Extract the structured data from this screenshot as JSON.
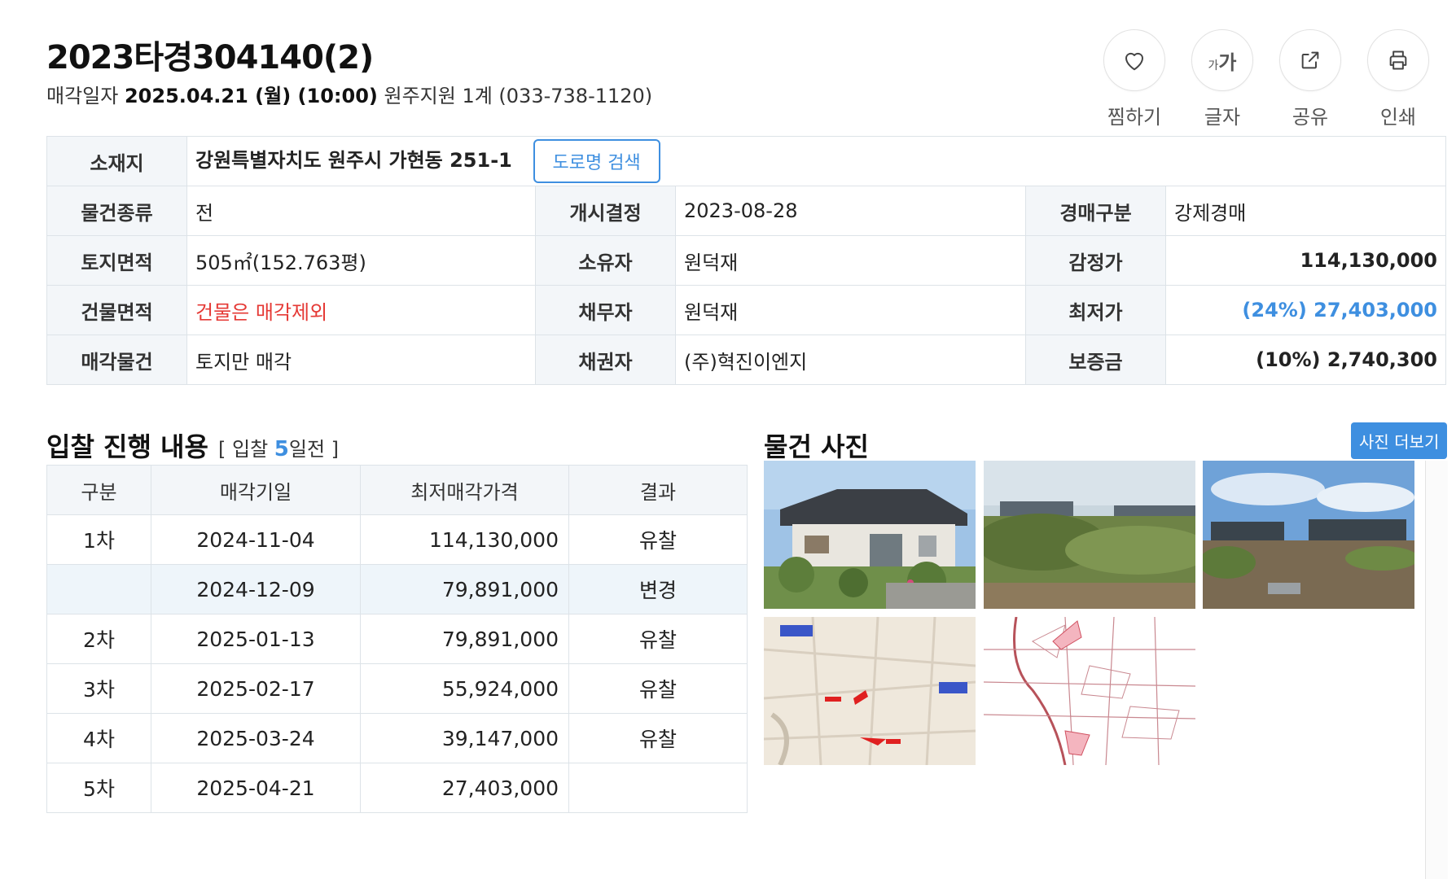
{
  "header": {
    "title": "2023타경304140(2)",
    "sale_label": "매각일자",
    "sale_date": "2025.04.21 (월) (10:00)",
    "court": "원주지원 1계 (033-738-1120)"
  },
  "actions": [
    {
      "label": "찜하기",
      "icon": "heart-icon"
    },
    {
      "label": "글자",
      "icon": "font-size-icon"
    },
    {
      "label": "공유",
      "icon": "share-icon"
    },
    {
      "label": "인쇄",
      "icon": "print-icon"
    }
  ],
  "font_icon": {
    "small": "가",
    "large": "가"
  },
  "info": {
    "location_label": "소재지",
    "location": "강원특별자치도 원주시 가현동 251-1",
    "road_search": "도로명 검색",
    "rows": [
      {
        "l1": "물건종류",
        "v1": "전",
        "l2": "개시결정",
        "v2": "2023-08-28",
        "l3": "경매구분",
        "v3": "강제경매"
      },
      {
        "l1": "토지면적",
        "v1": "505㎡(152.763평)",
        "l2": "소유자",
        "v2": "원덕재",
        "l3": "감정가",
        "v3": "114,130,000"
      },
      {
        "l1": "건물면적",
        "v1": "건물은 매각제외",
        "l2": "채무자",
        "v2": "원덕재",
        "l3": "최저가",
        "v3": "(24%) 27,403,000"
      },
      {
        "l1": "매각물건",
        "v1": "토지만 매각",
        "l2": "채권자",
        "v2": "(주)혁진이엔지",
        "l3": "보증금",
        "v3": "(10%) 2,740,300"
      }
    ],
    "colors": {
      "warning": "#e53935",
      "accent": "#3e8fe0"
    }
  },
  "bid_section": {
    "title": "입찰 진행 내용",
    "note_prefix": "[ 입찰",
    "note_count": "5",
    "note_suffix": "일전 ]",
    "headers": [
      "구분",
      "매각기일",
      "최저매각가격",
      "결과"
    ],
    "rows": [
      {
        "round": "1차",
        "date": "2024-11-04",
        "price": "114,130,000",
        "result": "유찰"
      },
      {
        "round": "",
        "date": "2024-12-09",
        "price": "79,891,000",
        "result": "변경"
      },
      {
        "round": "2차",
        "date": "2025-01-13",
        "price": "79,891,000",
        "result": "유찰"
      },
      {
        "round": "3차",
        "date": "2025-02-17",
        "price": "55,924,000",
        "result": "유찰"
      },
      {
        "round": "4차",
        "date": "2025-03-24",
        "price": "39,147,000",
        "result": "유찰"
      },
      {
        "round": "5차",
        "date": "2025-04-21",
        "price": "27,403,000",
        "result": ""
      }
    ]
  },
  "photo_section": {
    "title": "물건 사진",
    "more_button": "사진 더보기",
    "photos": [
      "house-photo",
      "field-photo-1",
      "field-photo-2",
      "location-map",
      "cadastral-map"
    ]
  }
}
